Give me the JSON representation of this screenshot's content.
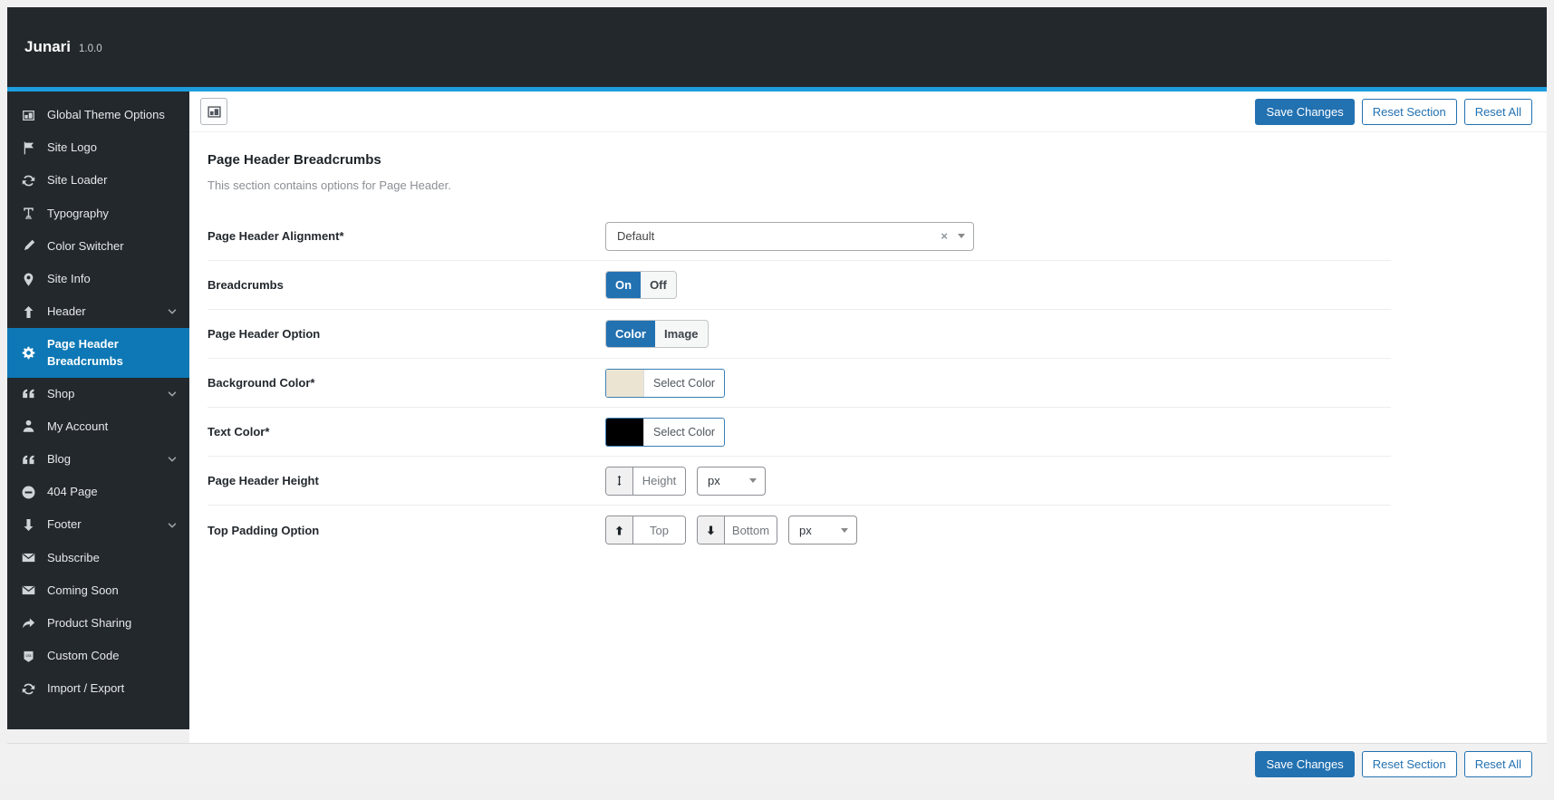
{
  "app": {
    "brand": "Junari",
    "version": "1.0.0"
  },
  "actions": {
    "save": "Save Changes",
    "reset_section": "Reset Section",
    "reset_all": "Reset All"
  },
  "sidebar": {
    "items": [
      {
        "label": "Global Theme Options",
        "icon": "layout-icon"
      },
      {
        "label": "Site Logo",
        "icon": "flag-icon"
      },
      {
        "label": "Site Loader",
        "icon": "sync-icon"
      },
      {
        "label": "Typography",
        "icon": "typography-icon"
      },
      {
        "label": "Color Switcher",
        "icon": "brush-icon"
      },
      {
        "label": "Site Info",
        "icon": "pin-icon"
      },
      {
        "label": "Header",
        "icon": "arrow-up-icon",
        "chevron": true
      },
      {
        "label": "Page Header Breadcrumbs",
        "icon": "gear-icon",
        "active": true
      },
      {
        "label": "Shop",
        "icon": "quote-icon",
        "chevron": true
      },
      {
        "label": "My Account",
        "icon": "user-icon"
      },
      {
        "label": "Blog",
        "icon": "quote-icon",
        "chevron": true
      },
      {
        "label": "404 Page",
        "icon": "minus-circle-icon"
      },
      {
        "label": "Footer",
        "icon": "arrow-down-icon",
        "chevron": true
      },
      {
        "label": "Subscribe",
        "icon": "envelope-icon"
      },
      {
        "label": "Coming Soon",
        "icon": "envelope-icon"
      },
      {
        "label": "Product Sharing",
        "icon": "share-icon"
      },
      {
        "label": "Custom Code",
        "icon": "code-icon"
      },
      {
        "label": "Import / Export",
        "icon": "sync-icon"
      }
    ]
  },
  "section": {
    "title": "Page Header Breadcrumbs",
    "description": "This section contains options for Page Header."
  },
  "fields": [
    {
      "label": "Page Header Alignment*",
      "type": "select",
      "value": "Default"
    },
    {
      "label": "Breadcrumbs",
      "type": "switch",
      "on": "On",
      "off": "Off",
      "active": "On"
    },
    {
      "label": "Page Header Option",
      "type": "switch",
      "on": "Color",
      "off": "Image",
      "active": "Color"
    },
    {
      "label": "Background Color*",
      "type": "color",
      "button": "Select Color",
      "swatch": "#ece4d3",
      "swatch_css": "background-color:#ece4d3"
    },
    {
      "label": "Text Color*",
      "type": "color",
      "button": "Select Color",
      "swatch": "#000000",
      "swatch_css": "background-color:#000000"
    },
    {
      "label": "Page Header Height",
      "type": "dimensions",
      "inputs": [
        {
          "placeholder": "Height",
          "icon": "v-arrow-icon"
        }
      ],
      "unit": "px"
    },
    {
      "label": "Top Padding Option",
      "type": "dimensions",
      "inputs": [
        {
          "placeholder": "Top",
          "icon": "arrow-up-icon"
        },
        {
          "placeholder": "Bottom",
          "icon": "arrow-down-icon"
        }
      ],
      "unit": "px"
    }
  ],
  "colors": {
    "topbar_bg": "#23282d",
    "topbar_line": "#1e9ddd",
    "sidebar_active": "#0d78b5",
    "accent": "#2271b1",
    "footer_bg": "#f1f1f1"
  }
}
